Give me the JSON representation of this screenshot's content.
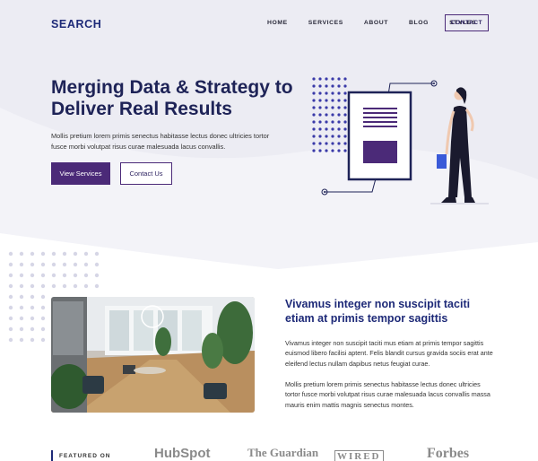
{
  "header": {
    "brand": "SEARCH",
    "nav": [
      "HOME",
      "SERVICES",
      "ABOUT",
      "BLOG",
      "STYLES"
    ],
    "contact_label": "CONTACT"
  },
  "hero": {
    "headline": "Merging Data & Strategy to Deliver Real Results",
    "text": "Mollis pretium lorem primis senectus habitasse lectus donec ultricies tortor fusce morbi volutpat risus curae malesuada lacus convallis.",
    "primary_button": "View Services",
    "secondary_button": "Contact Us"
  },
  "about": {
    "title": "Vivamus integer non suscipit taciti etiam at primis tempor sagittis",
    "paragraph1": "Vivamus integer non suscipit taciti mus etiam at primis tempor sagittis euismod libero facilisi aptent. Felis blandit cursus gravida sociis erat ante eleifend lectus nullam dapibus netus feugiat curae.",
    "paragraph2": "Mollis pretium lorem primis senectus habitasse lectus donec ultricies tortor fusce morbi volutpat risus curae malesuada lacus convallis massa mauris enim mattis magnis senectus montes."
  },
  "featured": {
    "label": "FEATURED ON",
    "logos": [
      "HubSpot",
      "The Guardian",
      "WIRED",
      "Forbes"
    ]
  },
  "colors": {
    "brand": "#1e2a78",
    "accent": "#4b2a78",
    "hero_bg": "#f3f3f8"
  }
}
